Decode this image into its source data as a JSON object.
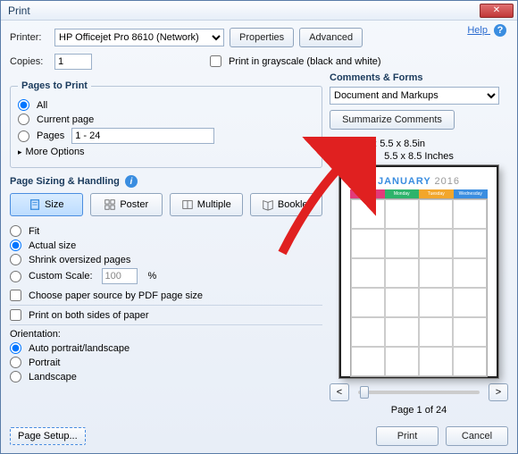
{
  "window": {
    "title": "Print"
  },
  "help": {
    "label": "Help"
  },
  "printer": {
    "label": "Printer:",
    "selected": "HP Officejet Pro 8610 (Network)",
    "properties_btn": "Properties",
    "advanced_btn": "Advanced"
  },
  "copies": {
    "label": "Copies:",
    "value": "1"
  },
  "grayscale": {
    "label": "Print in grayscale (black and white)"
  },
  "pages_to_print": {
    "legend": "Pages to Print",
    "all": "All",
    "current": "Current page",
    "pages": "Pages",
    "pages_value": "1 - 24",
    "more_options": "More Options"
  },
  "sizing": {
    "title": "Page Sizing & Handling",
    "size": "Size",
    "poster": "Poster",
    "multiple": "Multiple",
    "booklet": "Booklet",
    "fit": "Fit",
    "actual": "Actual size",
    "shrink": "Shrink oversized pages",
    "custom_scale": "Custom Scale:",
    "custom_value": "100",
    "percent": "%",
    "choose_paper": "Choose paper source by PDF page size",
    "both_sides": "Print on both sides of paper",
    "orientation_label": "Orientation:",
    "auto": "Auto portrait/landscape",
    "portrait": "Portrait",
    "landscape": "Landscape"
  },
  "comments": {
    "title": "Comments & Forms",
    "selected": "Document and Markups",
    "summarize": "Summarize Comments"
  },
  "preview": {
    "doc_size": "Document: 5.5 x 8.5in",
    "paper_size": "5.5 x 8.5 Inches",
    "month": "JANUARY",
    "year": "2016",
    "days": [
      "Sunday",
      "Monday",
      "Tuesday",
      "Wednesday"
    ],
    "colors": [
      "#e23a7a",
      "#2db36b",
      "#f2a62b",
      "#3a8de0"
    ],
    "nav_prev": "<",
    "nav_next": ">",
    "page_label": "Page 1 of 24"
  },
  "footer": {
    "page_setup": "Page Setup...",
    "print": "Print",
    "cancel": "Cancel"
  }
}
